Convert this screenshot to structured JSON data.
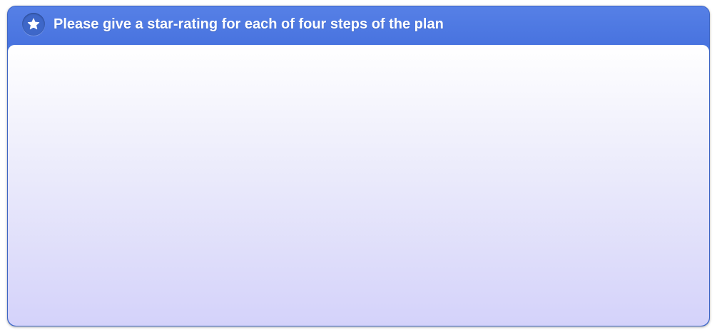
{
  "panel": {
    "title": "Please give a star-rating for each of four steps of the plan",
    "icon": "star-icon"
  },
  "colors": {
    "header": "#4a78e0",
    "body_top": "#ffffff",
    "body_bottom": "#d4d2fa",
    "title_text": "#ffffff"
  }
}
